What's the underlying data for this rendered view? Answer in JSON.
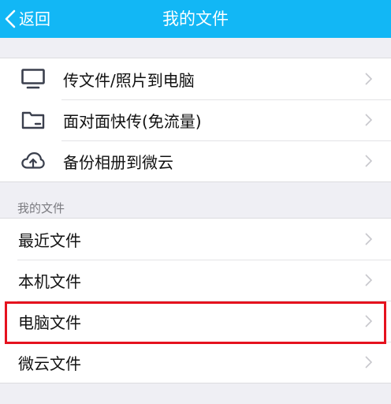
{
  "header": {
    "back_label": "返回",
    "title": "我的文件",
    "background_color": "#12b7f5"
  },
  "actions": [
    {
      "label": "传文件/照片到电脑",
      "icon": "monitor-icon"
    },
    {
      "label": "面对面快传(免流量)",
      "icon": "folder-icon"
    },
    {
      "label": "备份相册到微云",
      "icon": "cloud-upload-icon"
    }
  ],
  "my_files": {
    "section_label": "我的文件",
    "items": [
      {
        "label": "最近文件"
      },
      {
        "label": "本机文件"
      },
      {
        "label": "电脑文件",
        "highlighted": true
      },
      {
        "label": "微云文件"
      }
    ]
  },
  "colors": {
    "highlight_border": "#e5121e",
    "chevron": "#c7c7cc",
    "icon": "#3a3f4d"
  }
}
